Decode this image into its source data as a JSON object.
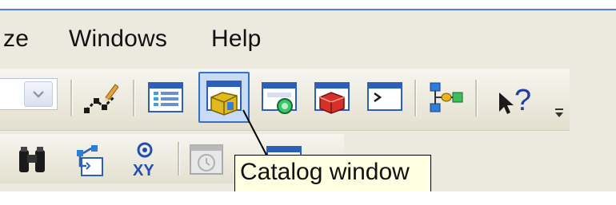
{
  "menu": {
    "items": [
      {
        "label": "ze"
      },
      {
        "label": "Windows"
      },
      {
        "label": "Help"
      }
    ]
  },
  "toolbar1": {
    "buttons": [
      {
        "icon": "editor-pencil-icon"
      },
      {
        "icon": "table-of-contents-icon"
      },
      {
        "icon": "catalog-window-icon"
      },
      {
        "icon": "search-window-icon"
      },
      {
        "icon": "arctoolbox-icon"
      },
      {
        "icon": "python-window-icon"
      },
      {
        "icon": "modelbuilder-icon"
      },
      {
        "icon": "whats-this-help-icon"
      }
    ],
    "pressed_button": "catalog-window-icon"
  },
  "toolbar2": {
    "buttons": [
      {
        "icon": "find-binoculars-icon"
      },
      {
        "icon": "find-route-icon"
      },
      {
        "icon": "go-to-xy-icon",
        "text": "XY"
      },
      {
        "icon": "time-slider-icon"
      },
      {
        "icon": "window-icon"
      }
    ]
  },
  "tooltip": {
    "text": "Catalog window"
  },
  "colors": {
    "accent": "#3770c8",
    "tooltip_bg": "#ffffe1",
    "toolbar_bg": "#eceadf"
  }
}
